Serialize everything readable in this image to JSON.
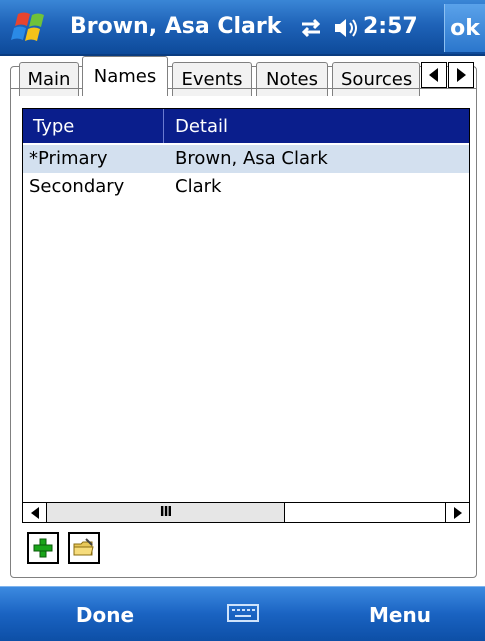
{
  "titlebar": {
    "title": "Brown, Asa Clark",
    "clock": "2:57",
    "ok_label": "ok",
    "start_icon": "windows-flag-icon",
    "connectivity_icon": "connectivity-arrows-icon",
    "volume_icon": "speaker-icon"
  },
  "tabs": [
    {
      "label": "Main",
      "active": false
    },
    {
      "label": "Names",
      "active": true
    },
    {
      "label": "Events",
      "active": false
    },
    {
      "label": "Notes",
      "active": false
    },
    {
      "label": "Sources",
      "active": false
    }
  ],
  "tab_scroll": {
    "left_icon": "triangle-left-icon",
    "right_icon": "triangle-right-icon"
  },
  "listview": {
    "columns": [
      "Type",
      "Detail"
    ],
    "rows": [
      {
        "type": "*Primary",
        "detail": "Brown, Asa Clark",
        "selected": true
      },
      {
        "type": "Secondary",
        "detail": "Clark",
        "selected": false
      }
    ],
    "scroll_thumb_glyph": "III"
  },
  "toolbar": {
    "add_icon": "green-plus-icon",
    "edit_icon": "folder-edit-icon"
  },
  "menubar": {
    "left_label": "Done",
    "right_label": "Menu",
    "center_icon": "keyboard-icon"
  },
  "colors": {
    "titlebar": "#1f63b8",
    "list_header": "#0a1e8c",
    "selected_row": "#d3e0ef",
    "menubar": "#1a63c2"
  }
}
